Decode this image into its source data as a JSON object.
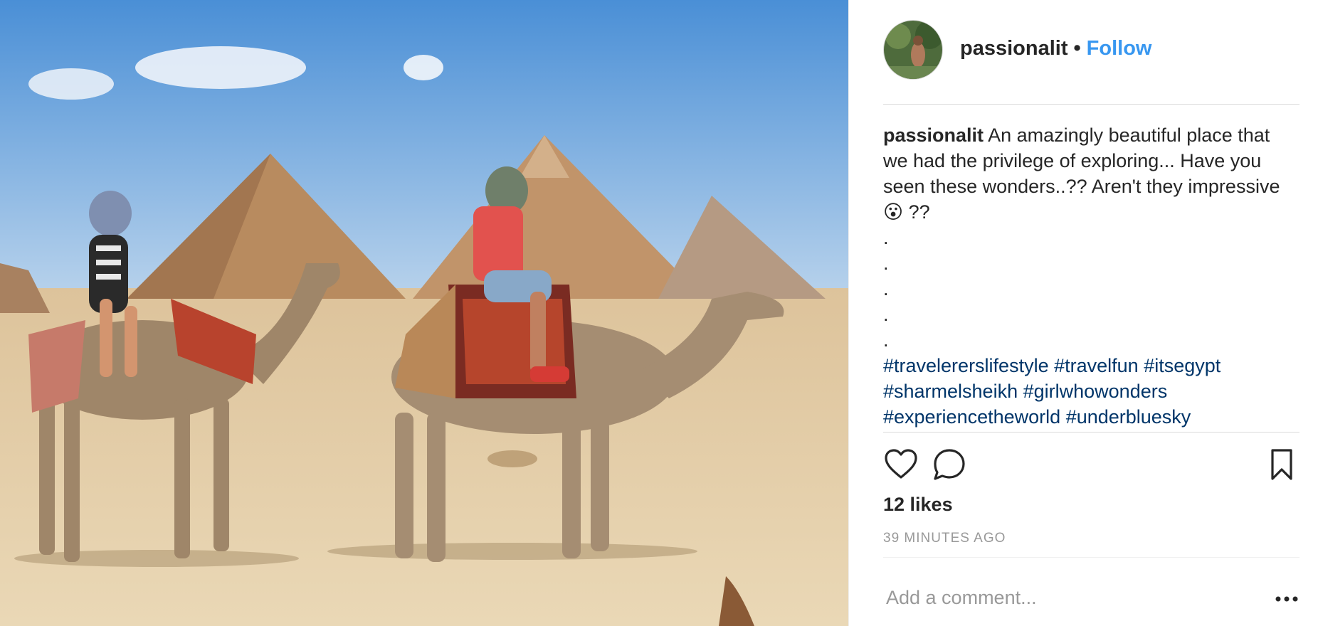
{
  "post": {
    "username": "passionalit",
    "separator": "•",
    "follow_label": "Follow",
    "caption_text": "An amazingly beautiful place that we had the privilege of exploring... Have you seen these wonders..?? Aren't they impressive 😮 ??",
    "caption_dots": [
      ".",
      ".",
      ".",
      ".",
      "."
    ],
    "hashtags": [
      "#travelererslifestyle",
      "#travelfun",
      "#itsegypt",
      "#sharmelsheikh",
      "#girlwhowonders",
      "#experiencetheworld",
      "#underbluesky"
    ],
    "likes": "12 likes",
    "time_ago": "39 MINUTES AGO"
  },
  "comment": {
    "placeholder": "Add a comment..."
  },
  "icons": {
    "like": "heart-icon",
    "comment": "comment-icon",
    "save": "bookmark-icon",
    "more": "more-options-icon"
  },
  "colors": {
    "follow": "#3897f0",
    "hashtag": "#003569",
    "text": "#262626",
    "muted": "#999999",
    "border": "#dbdbdb"
  }
}
